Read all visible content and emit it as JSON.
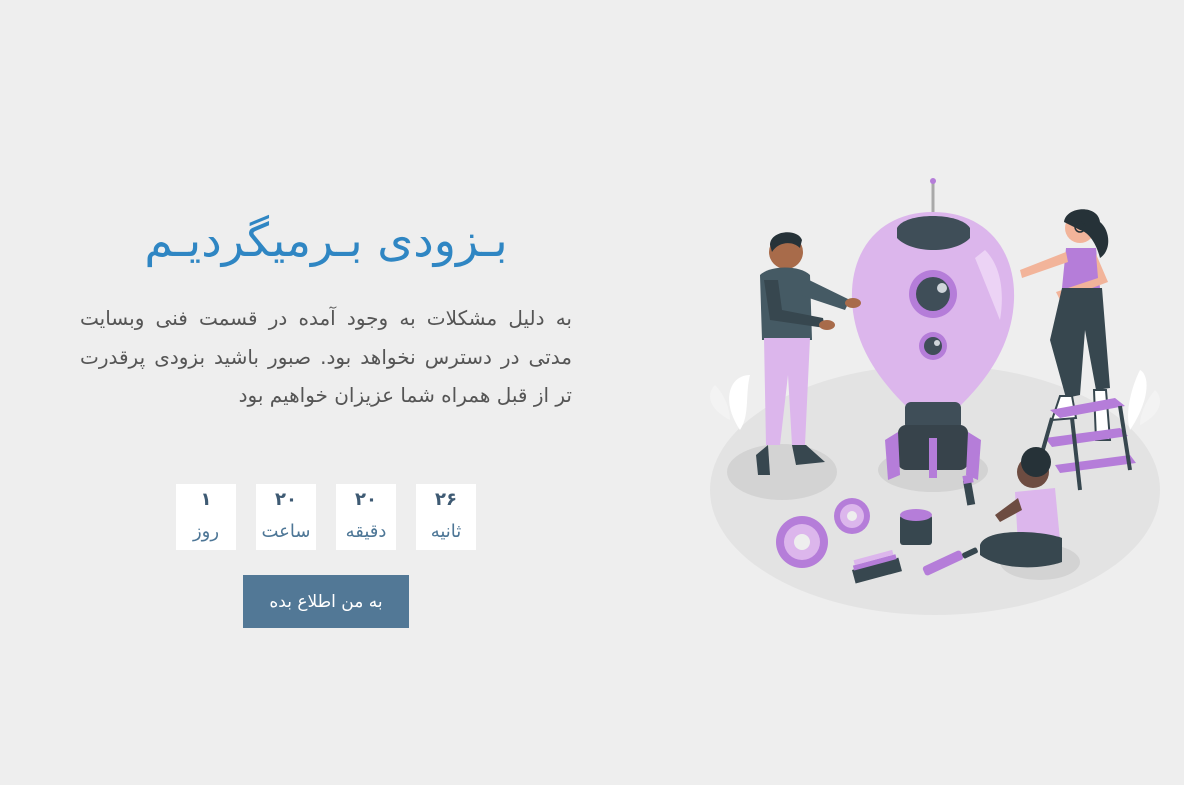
{
  "page": {
    "title": "بـزودی بـرمیگردیـم",
    "description": "به دلیل مشکلات به وجود آمده در قسمت فنی وبسایت مدتی در دسترس نخواهد بود. صبور باشید بزودی پرقدرت تر از قبل همراه شما عزیزان خواهیم بود"
  },
  "countdown": [
    {
      "value": "۱",
      "label": "روز"
    },
    {
      "value": "۲۰",
      "label": "ساعت"
    },
    {
      "value": "۲۰",
      "label": "دقیقه"
    },
    {
      "value": "۲۶",
      "label": "ثانیه"
    }
  ],
  "notify_button": {
    "label": "به من اطلاع بده"
  },
  "colors": {
    "background": "#eeeeee",
    "title": "#2f86c3",
    "button": "#527896",
    "accent_purple": "#b57dd9",
    "light_purple": "#dcb6ec"
  }
}
